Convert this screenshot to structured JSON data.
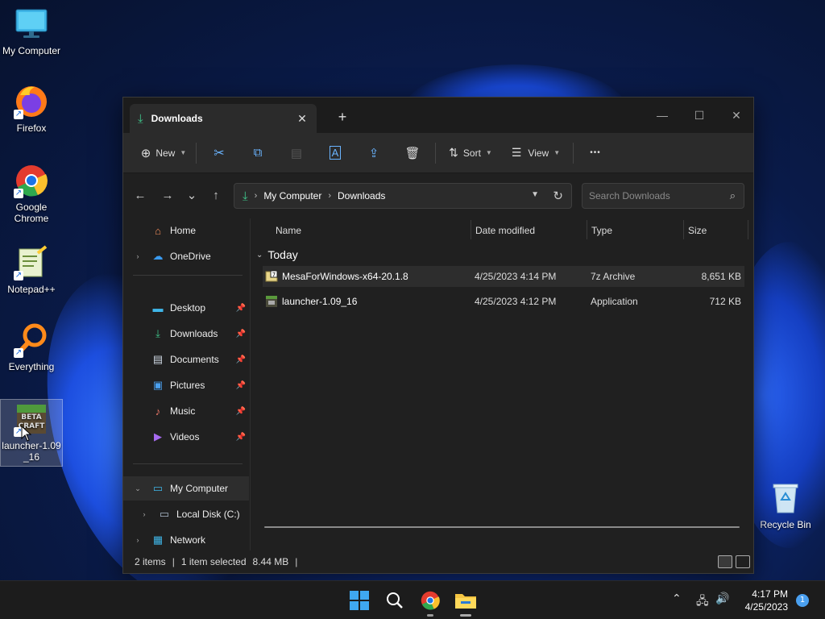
{
  "desktop": {
    "icons": [
      {
        "label": "My Computer"
      },
      {
        "label": "Firefox"
      },
      {
        "label": "Google Chrome"
      },
      {
        "label": "Notepad++"
      },
      {
        "label": "Everything"
      },
      {
        "label": "launcher-1.09_16"
      },
      {
        "label": "Recycle Bin"
      }
    ],
    "shortcut_glyph": "↗"
  },
  "window": {
    "tab_title": "Downloads",
    "close_glyph": "✕",
    "new_tab_glyph": "+",
    "controls": {
      "minimize": "—",
      "maximize": "☐",
      "close": "✕"
    },
    "toolbar": {
      "new_label": "New",
      "sort_label": "Sort",
      "view_label": "View",
      "more_glyph": "•••"
    },
    "nav": {
      "back": "←",
      "forward": "→",
      "recent": "⌄",
      "up": "↑"
    },
    "address": {
      "crumbs": [
        "My Computer",
        "Downloads"
      ],
      "separator": "›"
    },
    "search": {
      "placeholder": "Search Downloads"
    },
    "sidebar": {
      "items": [
        {
          "label": "Home"
        },
        {
          "label": "OneDrive"
        },
        {
          "label": "Desktop"
        },
        {
          "label": "Downloads"
        },
        {
          "label": "Documents"
        },
        {
          "label": "Pictures"
        },
        {
          "label": "Music"
        },
        {
          "label": "Videos"
        },
        {
          "label": "My Computer"
        },
        {
          "label": "Local Disk (C:)"
        },
        {
          "label": "Network"
        }
      ]
    },
    "columns": {
      "name": "Name",
      "date": "Date modified",
      "type": "Type",
      "size": "Size"
    },
    "group": "Today",
    "files": [
      {
        "name": "MesaForWindows-x64-20.1.8",
        "date": "4/25/2023 4:14 PM",
        "type": "7z Archive",
        "size": "8,651 KB"
      },
      {
        "name": "launcher-1.09_16",
        "date": "4/25/2023 4:12 PM",
        "type": "Application",
        "size": "712 KB"
      }
    ],
    "status": {
      "items": "2 items",
      "selected": "1 item selected",
      "size": "8.44 MB",
      "bar": "|"
    }
  },
  "taskbar": {
    "time": "4:17 PM",
    "date": "4/25/2023",
    "notifications": "1"
  },
  "colors": {
    "accent": "#4aa0f0",
    "window_bg": "#202020",
    "toolbar_bg": "#2b2b2b",
    "selection": "#2d2d2d"
  }
}
